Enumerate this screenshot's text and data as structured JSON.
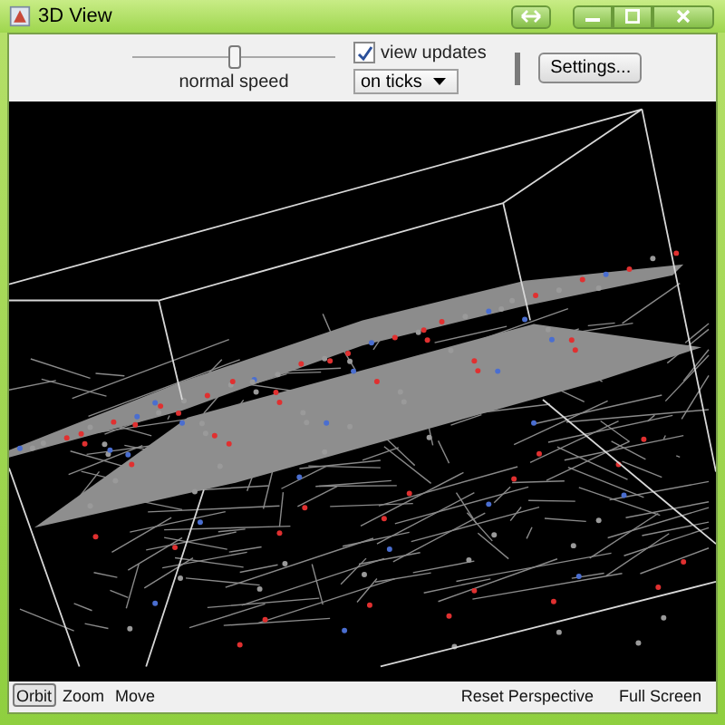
{
  "window": {
    "title": "3D View"
  },
  "speed_slider": {
    "label": "normal speed",
    "level": 0.5
  },
  "view_updates": {
    "label": "view updates",
    "checked": true
  },
  "update_mode": {
    "value": "on ticks"
  },
  "settings_button": {
    "label": "Settings..."
  },
  "nav_modes": [
    {
      "label": "Orbit",
      "selected": true
    },
    {
      "label": "Zoom",
      "selected": false
    },
    {
      "label": "Move",
      "selected": false
    }
  ],
  "actions": [
    {
      "label": "Reset Perspective"
    },
    {
      "label": "Full Screen"
    }
  ]
}
